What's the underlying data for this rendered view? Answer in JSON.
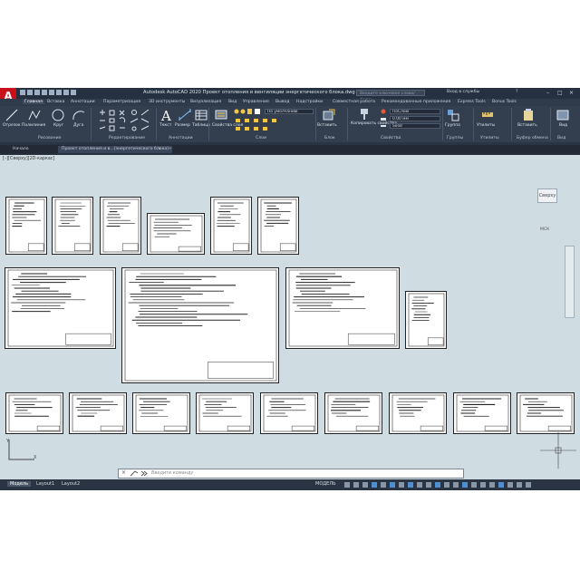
{
  "titlebar": {
    "logo": "A",
    "title": "Autodesk AutoCAD 2020   Проект отопления и вентиляции энергетического блока.dwg",
    "search_placeholder": "Введите ключевое слово/фразу",
    "signin": "Вход в службы",
    "help": "?"
  },
  "ribbon_tabs": [
    "Главная",
    "Вставка",
    "Аннотации",
    "Параметризация",
    "3D инструменты",
    "Визуализация",
    "Вид",
    "Управление",
    "Вывод",
    "Надстройки",
    "Совместная работа",
    "Рекомендованные приложения",
    "Express Tools",
    "Bonus Tools"
  ],
  "ribbon": {
    "draw_tools": [
      "Отрезок",
      "Полилиния",
      "Круг",
      "Дуга"
    ],
    "text": "Текст",
    "dimension": "Размер",
    "table": "Таблица",
    "layer_props": "Свойства слоя",
    "insert": "Вставить",
    "match_props": "Копировать свойства",
    "group": "Группа",
    "utilities": "Утилиты",
    "paste": "Вставить",
    "view": "Вид",
    "layer_value": "По умолчанию",
    "color_value": "ПоСлою",
    "lineweight_value": "0.00 мм",
    "linetype_value": "Solid",
    "panels": [
      "Рисование",
      "Редактирование",
      "Аннотации",
      "Слои",
      "Блок",
      "Свойства",
      "Группы",
      "Утилиты",
      "Буфер обмена",
      "Вид"
    ]
  },
  "file_tabs": [
    "Начало",
    "Проект отопления и в...(энергетического блока)"
  ],
  "viewport_label": "[–][Сверху][2D-каркас]",
  "viewcube": {
    "face": "Сверху",
    "ucs": "МСК"
  },
  "command_placeholder": "Введите команду",
  "layout_tabs": [
    "Модель",
    "Layout1",
    "Layout2"
  ],
  "status_model": "МОДЕЛЬ",
  "colors": {
    "background": "#cfdce2",
    "ribbon": "#333e4f",
    "accent": "#c8101b"
  }
}
